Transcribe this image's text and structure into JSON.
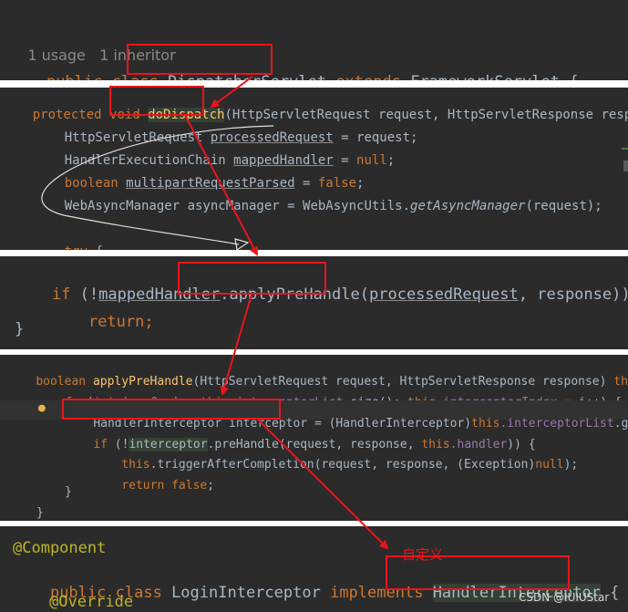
{
  "panel1": {
    "usage": "1 usage",
    "inheritor": "1 inheritor",
    "kw_public": "public",
    "kw_class": "class",
    "class_name": "DispatcherServlet",
    "kw_extends": "extends",
    "super_name": "FrameworkServlet",
    "brace": " {"
  },
  "panel2": {
    "kw_protected": "protected",
    "kw_void": "void",
    "method_name": "doDispatch",
    "signature_rest": "(HttpServletRequest request, HttpServletResponse respon",
    "line2_type": "HttpServletRequest ",
    "line2_var": "processedRequest",
    "line2_rest": " = request;",
    "line3_type": "HandlerExecutionChain ",
    "line3_var": "mappedHandler",
    "line3_eq": " = ",
    "line3_val": "null",
    "line3_end": ";",
    "line4_kw": "boolean ",
    "line4_var": "multipartRequestParsed",
    "line4_eq": " = ",
    "line4_val": "false",
    "line4_end": ";",
    "line5_text": "WebAsyncManager asyncManager = WebAsyncUtils.",
    "line5_call": "getAsyncManager",
    "line5_end": "(request);",
    "line6_kw": "try",
    "line6_end": " {"
  },
  "panel3": {
    "kw_if": "if",
    "open": " (!",
    "var": "mappedHandler",
    "call": ".applyPreHandle",
    "paren": "(",
    "arg1": "processedRequest",
    "rest": ", response)) {",
    "kw_return": "return",
    "semi": ";",
    "close": "}"
  },
  "panel4": {
    "kw_boolean": "boolean",
    "method_name": "applyPreHandle",
    "signature": "(HttpServletRequest request, HttpServletResponse response) ",
    "kw_throws": "throws",
    "for_kw": "for",
    "for_open": "(",
    "for_int": "int",
    "for_i": " i = ",
    "for_zero": "0",
    "for_mid": "; i < ",
    "for_this": "this",
    "for_list": ".interceptorList",
    "for_size": ".size(); ",
    "for_this2": "this",
    "for_idx": ".interceptorIndex",
    "for_end": " = i++) {",
    "decl_text": "HandlerInterceptor interceptor",
    "decl_cast": " = (HandlerInterceptor)",
    "decl_this": "this",
    "decl_list": ".interceptorList",
    "decl_get": ".get(i);",
    "if_kw": "if",
    "if_open": " (!",
    "if_var": "interceptor",
    "if_call": ".preHandle(request, response, ",
    "if_this": "this",
    "if_handler": ".handler",
    "if_end": ")) {",
    "trig_this": "this",
    "trig_call": ".triggerAfterCompletion(request, response, (Exception)",
    "trig_null": "null",
    "trig_end": ");",
    "ret_kw": "return",
    "ret_false": " false",
    "ret_end": ";",
    "close1": "}",
    "close2": "}"
  },
  "panel5": {
    "annotation": "@Component",
    "kw_public": "public",
    "kw_class": "class",
    "class_name": "LoginInterceptor",
    "kw_implements": "implements",
    "iface": "HandlerInterceptor",
    "brace": " {",
    "override": "@Override"
  },
  "label_custom": "自定义",
  "watermark": "CSDN @IUIUStar",
  "colors": {
    "editor_bg": "#2b2b2b",
    "keyword": "#cc7832",
    "function": "#ffc66d",
    "annotation": "#bbb529",
    "highlight_red": "#e8151b"
  }
}
